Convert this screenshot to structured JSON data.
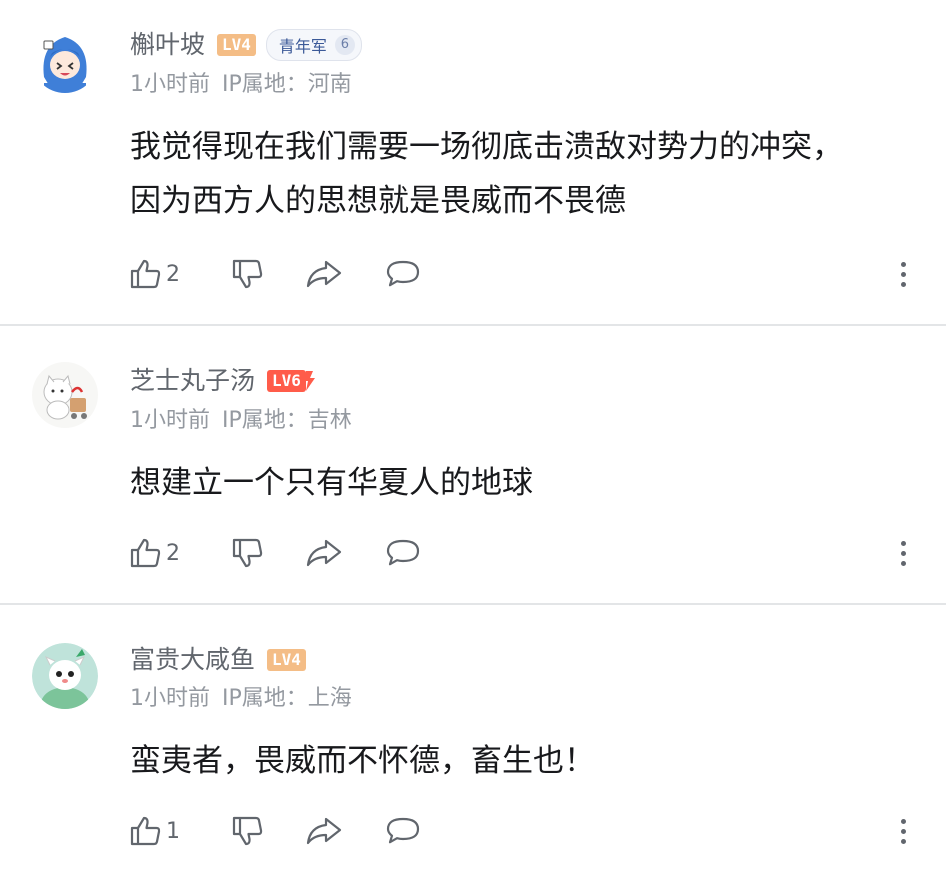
{
  "comments": [
    {
      "username": "槲叶坡",
      "level": "LV4",
      "fan_badge": {
        "label": "青年军",
        "count": "6"
      },
      "time": "1小时前",
      "ip_label": "IP属地：",
      "ip_location": "河南",
      "content": "我觉得现在我们需要一场彻底击溃敌对势力的冲突，因为西方人的思想就是畏威而不畏德",
      "likes": "2"
    },
    {
      "username": "芝士丸子汤",
      "level": "LV6",
      "time": "1小时前",
      "ip_label": "IP属地：",
      "ip_location": "吉林",
      "content": "想建立一个只有华夏人的地球",
      "likes": "2"
    },
    {
      "username": "富贵大咸鱼",
      "level": "LV4",
      "time": "1小时前",
      "ip_label": "IP属地：",
      "ip_location": "上海",
      "content": "蛮夷者，畏威而不怀德，畜生也！",
      "likes": "1"
    }
  ],
  "icons": {
    "like": "thumb-up-icon",
    "dislike": "thumb-down-icon",
    "share": "share-arrow-icon",
    "reply": "chat-bubble-icon",
    "more": "more-vertical-icon"
  },
  "colors": {
    "username": "#61666d",
    "meta": "#9499a0",
    "lv4": "#f4bd86",
    "lv6": "#ff5c4a",
    "divider": "#e3e5e7"
  }
}
